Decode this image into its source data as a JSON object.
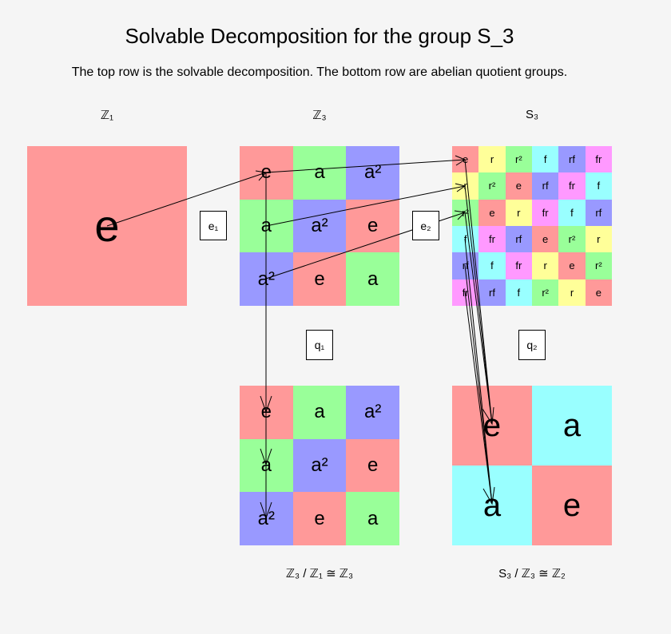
{
  "title": "Solvable Decomposition for the group S_3",
  "subtitle": "The top row is the solvable decomposition. The bottom row are abelian quotient groups.",
  "colors": {
    "e": "#ff9999",
    "a": "#99ff99",
    "a2": "#9999ff",
    "r": "#ffff99",
    "r2": "#99ff99",
    "f": "#99ffff",
    "rf": "#9999ff",
    "fr": "#ff99ff",
    "q_a": "#99ffff",
    "background": "#f5f5f5"
  },
  "groups": {
    "z1": {
      "label": "ℤ₁",
      "cells": [
        [
          "e"
        ]
      ],
      "colors": [
        [
          "e"
        ]
      ]
    },
    "z3": {
      "label": "ℤ₃",
      "cells": [
        [
          "e",
          "a",
          "a²"
        ],
        [
          "a",
          "a²",
          "e"
        ],
        [
          "a²",
          "e",
          "a"
        ]
      ],
      "colors": [
        [
          "e",
          "a",
          "a2"
        ],
        [
          "a",
          "a2",
          "e"
        ],
        [
          "a2",
          "e",
          "a"
        ]
      ]
    },
    "s3": {
      "label": "S₃",
      "cells": [
        [
          "e",
          "r",
          "r²",
          "f",
          "rf",
          "fr"
        ],
        [
          "r",
          "r²",
          "e",
          "rf",
          "fr",
          "f"
        ],
        [
          "r²",
          "e",
          "r",
          "fr",
          "f",
          "rf"
        ],
        [
          "f",
          "fr",
          "rf",
          "e",
          "r²",
          "r"
        ],
        [
          "rf",
          "f",
          "fr",
          "r",
          "e",
          "r²"
        ],
        [
          "fr",
          "rf",
          "f",
          "r²",
          "r",
          "e"
        ]
      ],
      "colors": [
        [
          "e",
          "r",
          "r2",
          "f",
          "rf",
          "fr"
        ],
        [
          "r",
          "r2",
          "e",
          "rf",
          "fr",
          "f"
        ],
        [
          "r2",
          "e",
          "r",
          "fr",
          "f",
          "rf"
        ],
        [
          "f",
          "fr",
          "rf",
          "e",
          "r2",
          "r"
        ],
        [
          "rf",
          "f",
          "fr",
          "r",
          "e",
          "r2"
        ],
        [
          "fr",
          "rf",
          "f",
          "r2",
          "r",
          "e"
        ]
      ]
    },
    "q1": {
      "label": "ℤ₃ / ℤ₁ ≅ ℤ₃",
      "cells": [
        [
          "e",
          "a",
          "a²"
        ],
        [
          "a",
          "a²",
          "e"
        ],
        [
          "a²",
          "e",
          "a"
        ]
      ],
      "colors": [
        [
          "e",
          "a",
          "a2"
        ],
        [
          "a",
          "a2",
          "e"
        ],
        [
          "a2",
          "e",
          "a"
        ]
      ]
    },
    "q2": {
      "label": "S₃ / ℤ₃ ≅ ℤ₂",
      "cells": [
        [
          "e",
          "a"
        ],
        [
          "a",
          "e"
        ]
      ],
      "colors": [
        [
          "e",
          "q_a"
        ],
        [
          "q_a",
          "e"
        ]
      ]
    }
  },
  "maps": {
    "e1": "e₁",
    "e2": "e₂",
    "q1": "q₁",
    "q2": "q₂"
  }
}
